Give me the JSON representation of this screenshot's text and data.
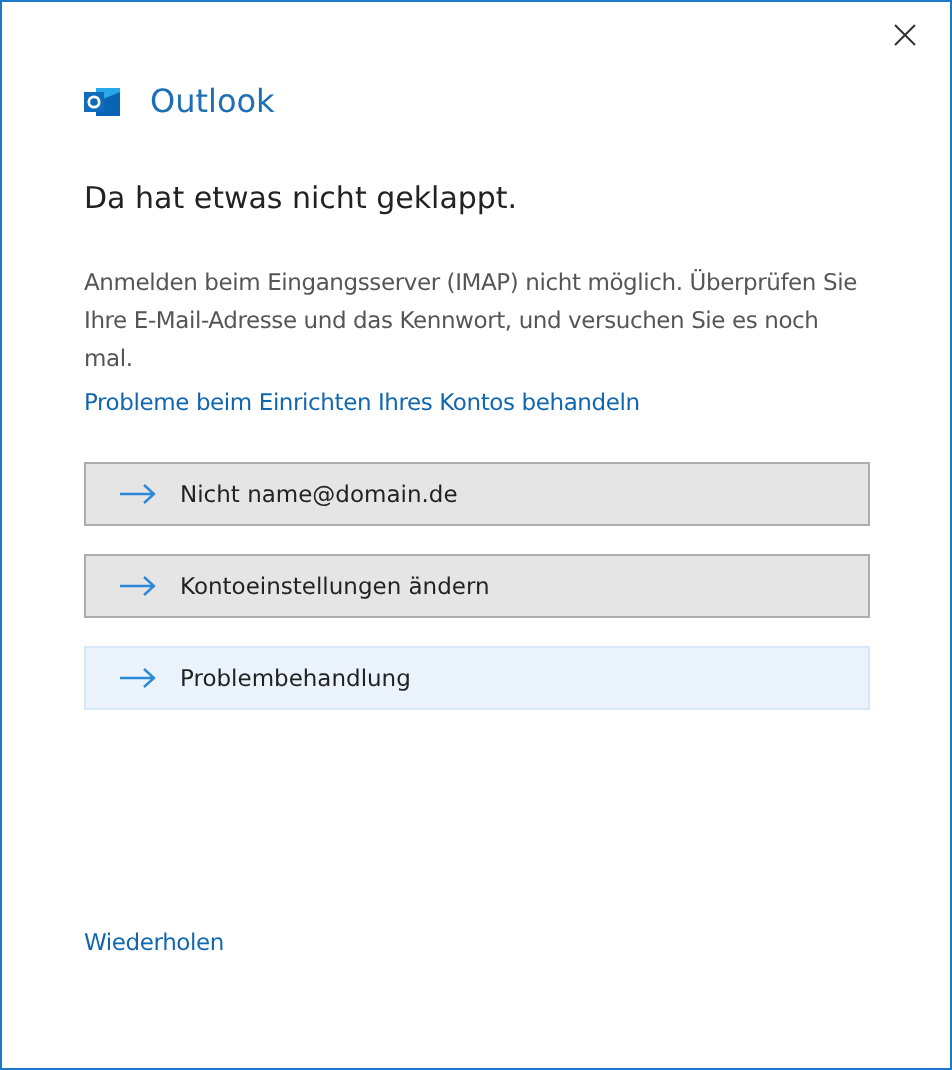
{
  "app": {
    "name": "Outlook"
  },
  "heading": "Da hat etwas nicht geklappt.",
  "message": "Anmelden beim Eingangsserver (IMAP) nicht möglich. Überprüfen Sie Ihre E-Mail-Adresse und das Kennwort, und versuchen Sie es noch mal.",
  "help_link": "Probleme beim Einrichten Ihres Kontos behandeln",
  "actions": [
    {
      "label": "Nicht name@domain.de",
      "selected": false
    },
    {
      "label": "Kontoeinstellungen ändern",
      "selected": false
    },
    {
      "label": "Problembehandlung",
      "selected": true
    }
  ],
  "retry_link": "Wiederholen"
}
